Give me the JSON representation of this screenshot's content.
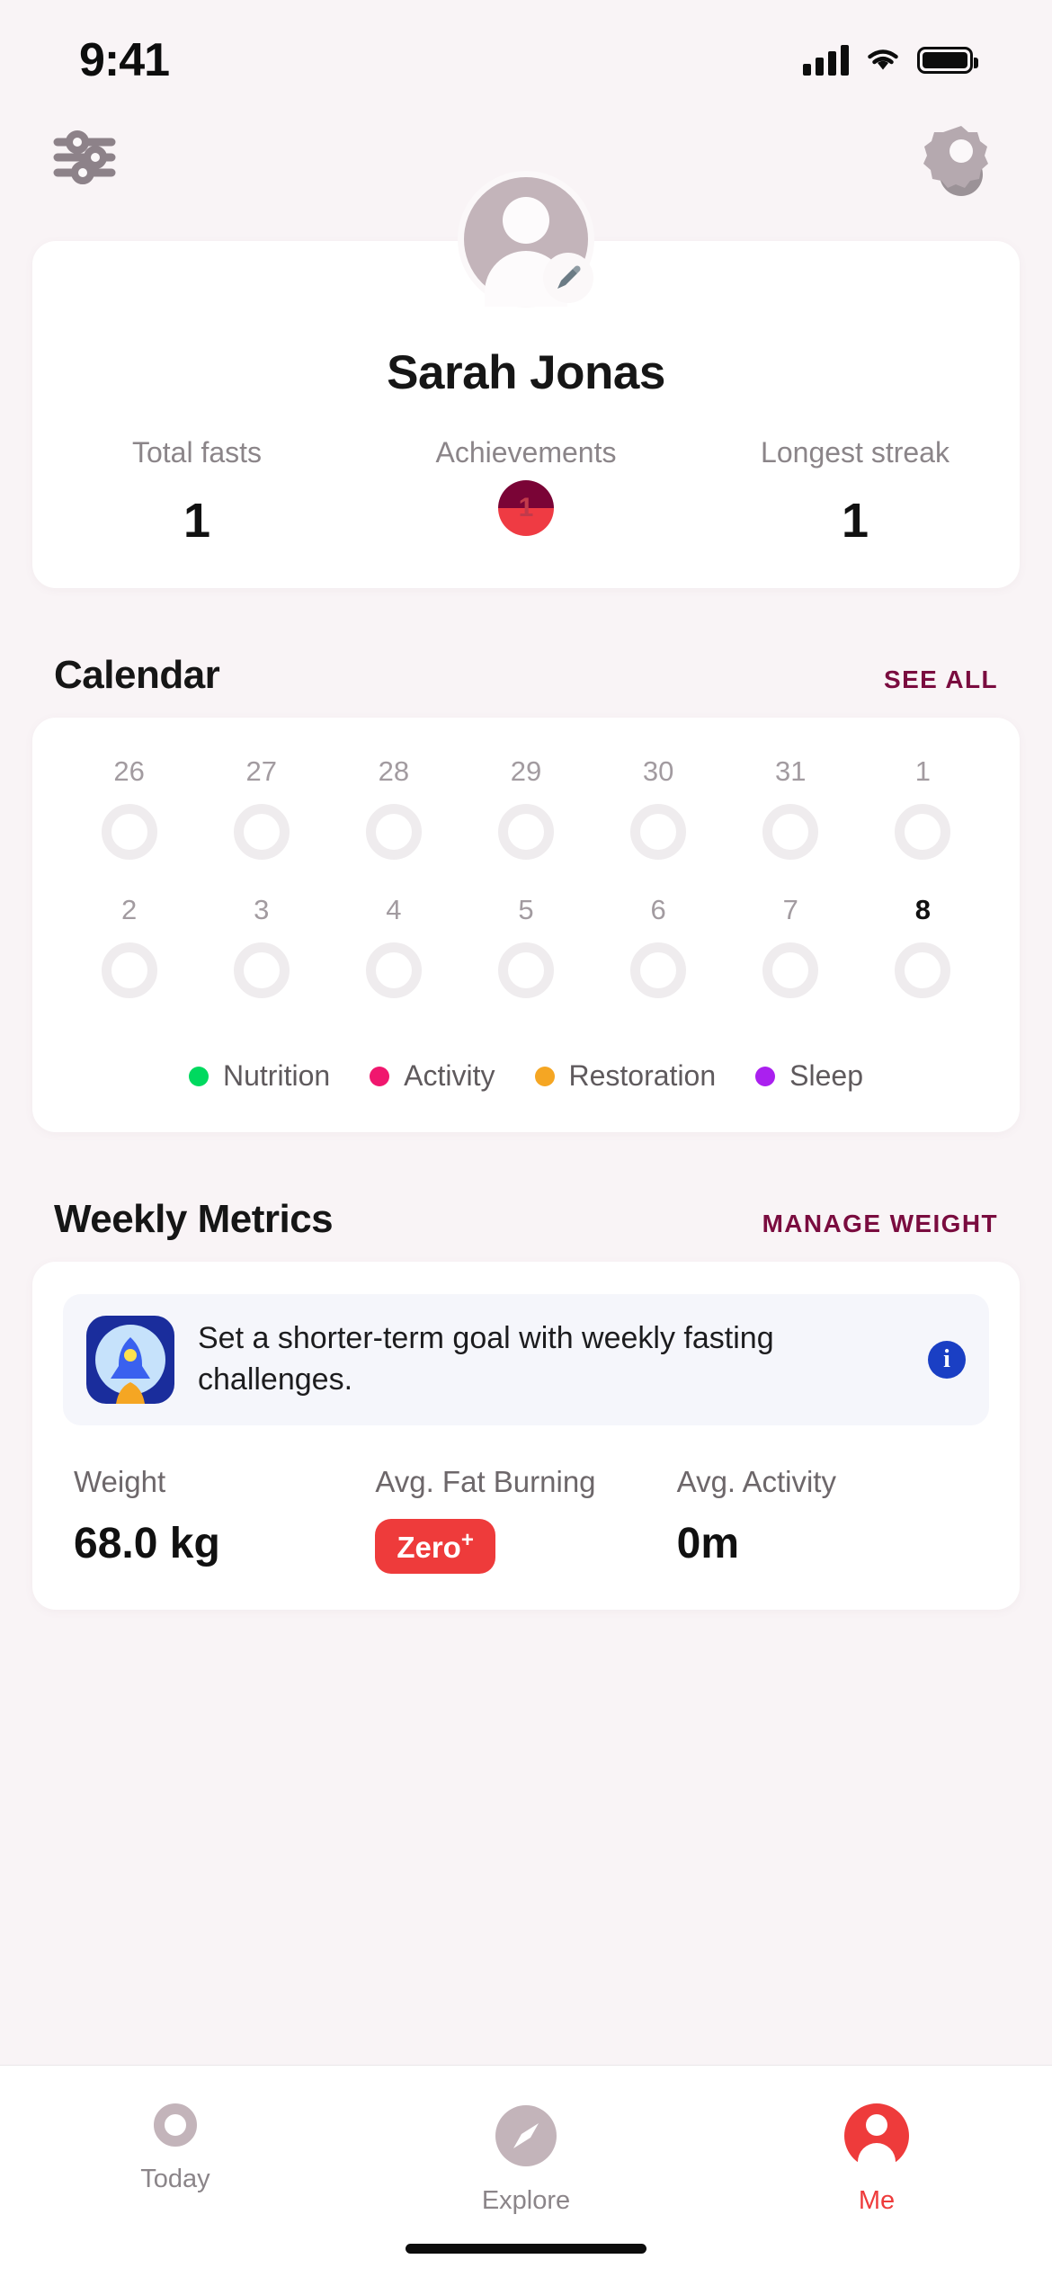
{
  "status_bar": {
    "time": "9:41",
    "signal_icon": "cellular-signal-icon",
    "wifi_icon": "wifi-icon",
    "battery_icon": "battery-icon"
  },
  "top_bar": {
    "filter_icon": "sliders-filter-icon",
    "settings_icon": "gear-settings-icon"
  },
  "profile": {
    "avatar_icon": "person-avatar-icon",
    "edit_icon": "pencil-edit-icon",
    "name": "Sarah Jonas",
    "stats": [
      {
        "label": "Total fasts",
        "value": "1",
        "type": "number"
      },
      {
        "label": "Achievements",
        "value": "1",
        "type": "badge"
      },
      {
        "label": "Longest streak",
        "value": "1",
        "type": "number"
      }
    ]
  },
  "calendar": {
    "title": "Calendar",
    "see_all_label": "SEE ALL",
    "rows": [
      [
        {
          "day": "26",
          "today": false
        },
        {
          "day": "27",
          "today": false
        },
        {
          "day": "28",
          "today": false
        },
        {
          "day": "29",
          "today": false
        },
        {
          "day": "30",
          "today": false
        },
        {
          "day": "31",
          "today": false
        },
        {
          "day": "1",
          "today": false
        }
      ],
      [
        {
          "day": "2",
          "today": false
        },
        {
          "day": "3",
          "today": false
        },
        {
          "day": "4",
          "today": false
        },
        {
          "day": "5",
          "today": false
        },
        {
          "day": "6",
          "today": false
        },
        {
          "day": "7",
          "today": false
        },
        {
          "day": "8",
          "today": true
        }
      ]
    ],
    "legend": [
      {
        "label": "Nutrition",
        "color": "#00d95f"
      },
      {
        "label": "Activity",
        "color": "#f0176e"
      },
      {
        "label": "Restoration",
        "color": "#f5a623"
      },
      {
        "label": "Sleep",
        "color": "#aa20ef"
      }
    ]
  },
  "weekly_metrics": {
    "title": "Weekly Metrics",
    "manage_weight_label": "MANAGE WEIGHT",
    "promo": {
      "icon": "rocket-icon",
      "text": "Set a shorter-term goal with weekly fasting challenges.",
      "info_icon": "info-icon",
      "info_glyph": "i"
    },
    "metrics": [
      {
        "label": "Weight",
        "value": "68.0 kg",
        "type": "text"
      },
      {
        "label": "Avg. Fat Burning",
        "value": "Zero",
        "suffix": "+",
        "type": "badge",
        "badge_color": "#ee3b3b"
      },
      {
        "label": "Avg. Activity",
        "value": "0m",
        "type": "text"
      }
    ]
  },
  "tab_bar": {
    "items": [
      {
        "label": "Today",
        "icon": "ring-today-icon",
        "active": false
      },
      {
        "label": "Explore",
        "icon": "compass-explore-icon",
        "active": false
      },
      {
        "label": "Me",
        "icon": "person-me-icon",
        "active": true
      }
    ],
    "active_color": "#ee3b3b"
  },
  "theme": {
    "background": "#f9f4f6",
    "card": "#ffffff",
    "accent_maroon": "#7a0c3f",
    "accent_red": "#ee3b3b"
  }
}
